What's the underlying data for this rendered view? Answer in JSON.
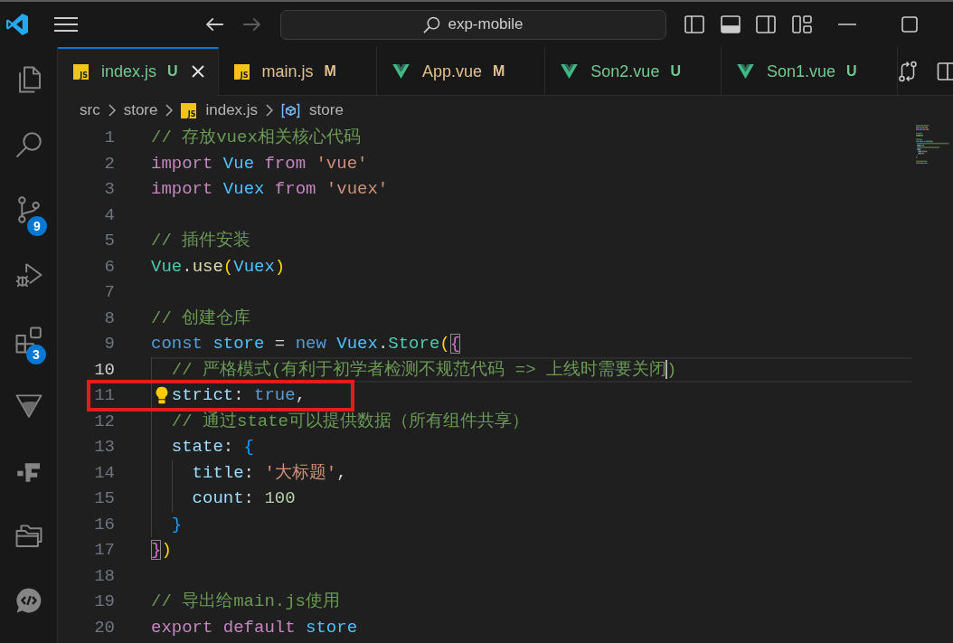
{
  "title_bar": {
    "navigation": [
      {
        "kind": "back",
        "disabled": false
      },
      {
        "kind": "forward",
        "disabled": true
      }
    ],
    "command_center": {
      "label": "exp-mobile"
    },
    "layout_toggles": [
      {
        "kind": "primary_sidebar",
        "on": false
      },
      {
        "kind": "panel",
        "on": true
      },
      {
        "kind": "secondary_sidebar",
        "on": false
      }
    ]
  },
  "activity_bar": [
    {
      "kind": "explorer"
    },
    {
      "kind": "search"
    },
    {
      "kind": "source_control",
      "badge": "9"
    },
    {
      "kind": "run_debug"
    },
    {
      "kind": "extensions",
      "badge": "3"
    },
    {
      "kind": "triangle"
    },
    {
      "kind": "blocks"
    },
    {
      "kind": "folders"
    },
    {
      "kind": "code_chat"
    }
  ],
  "tabs": [
    {
      "label": "index.js",
      "status": "U",
      "color": "#73c991",
      "icon": {
        "kind": "js",
        "text": "JS"
      },
      "selected": true
    },
    {
      "label": "main.js",
      "status": "M",
      "color": "#e2c08d",
      "icon": {
        "kind": "js",
        "text": "JS"
      },
      "selected": false
    },
    {
      "label": "App.vue",
      "status": "M",
      "color": "#e2c08d",
      "icon": {
        "kind": "vue"
      },
      "selected": false
    },
    {
      "label": "Son2.vue",
      "status": "U",
      "color": "#73c991",
      "icon": {
        "kind": "vue"
      },
      "selected": false
    },
    {
      "label": "Son1.vue",
      "status": "U",
      "color": "#73c991",
      "icon": {
        "kind": "vue"
      },
      "selected": false
    }
  ],
  "breadcrumbs": [
    {
      "label": "src"
    },
    {
      "label": "store"
    },
    {
      "label": "index.js",
      "icon": {
        "kind": "js",
        "text": "JS"
      }
    },
    {
      "label": "store",
      "icon": {
        "kind": "symbol"
      }
    }
  ],
  "editor": {
    "lines": [
      {
        "number": "1",
        "current": false,
        "lightbulb": false,
        "boxed": false,
        "tokens": [
          {
            "text": "// 存放vuex相关核心代码",
            "kind": "comment",
            "matched": false
          }
        ]
      },
      {
        "number": "2",
        "current": false,
        "lightbulb": false,
        "boxed": false,
        "tokens": [
          {
            "text": "import",
            "kind": "keyword",
            "matched": false
          },
          {
            "text": " Vue",
            "kind": "constant",
            "matched": false
          },
          {
            "text": " from",
            "kind": "keyword",
            "matched": false
          },
          {
            "text": " 'vue'",
            "kind": "string",
            "matched": false
          }
        ]
      },
      {
        "number": "3",
        "current": false,
        "lightbulb": false,
        "boxed": false,
        "tokens": [
          {
            "text": "import",
            "kind": "keyword",
            "matched": false
          },
          {
            "text": " Vuex",
            "kind": "constant",
            "matched": false
          },
          {
            "text": " from",
            "kind": "keyword",
            "matched": false
          },
          {
            "text": " 'vuex'",
            "kind": "string",
            "matched": false
          }
        ]
      },
      {
        "number": "4",
        "current": false,
        "lightbulb": false,
        "boxed": false
      },
      {
        "number": "5",
        "current": false,
        "lightbulb": false,
        "boxed": false,
        "tokens": [
          {
            "text": "// 插件安装",
            "kind": "comment",
            "matched": false
          }
        ]
      },
      {
        "number": "6",
        "current": false,
        "lightbulb": false,
        "boxed": false,
        "tokens": [
          {
            "text": "Vue",
            "kind": "class",
            "matched": false
          },
          {
            "text": ".",
            "kind": "punctuation",
            "matched": false
          },
          {
            "text": "use",
            "kind": "function",
            "matched": false
          },
          {
            "text": "(",
            "kind": "bracket1",
            "matched": false
          },
          {
            "text": "Vuex",
            "kind": "constant",
            "matched": false
          },
          {
            "text": ")",
            "kind": "bracket1",
            "matched": false
          }
        ]
      },
      {
        "number": "7",
        "current": false,
        "lightbulb": false,
        "boxed": false
      },
      {
        "number": "8",
        "current": false,
        "lightbulb": false,
        "boxed": false,
        "tokens": [
          {
            "text": "// 创建仓库",
            "kind": "comment",
            "matched": false
          }
        ]
      },
      {
        "number": "9",
        "current": false,
        "lightbulb": false,
        "boxed": false,
        "tokens": [
          {
            "text": "const",
            "kind": "storage",
            "matched": false
          },
          {
            "text": " store",
            "kind": "constant",
            "matched": false
          },
          {
            "text": " =",
            "kind": "punctuation",
            "matched": false
          },
          {
            "text": " new",
            "kind": "storage",
            "matched": false
          },
          {
            "text": " Vuex",
            "kind": "constant",
            "matched": false
          },
          {
            "text": ".",
            "kind": "punctuation",
            "matched": false
          },
          {
            "text": "Store",
            "kind": "class",
            "matched": false
          },
          {
            "text": "(",
            "kind": "bracket1",
            "matched": false
          },
          {
            "text": "{",
            "kind": "bracket2",
            "matched": true
          }
        ]
      },
      {
        "number": "10",
        "current": true,
        "lightbulb": false,
        "boxed": false,
        "tokens": [
          {
            "text": "  // 严格模式(有利于初学者检测不规范代码 => 上线时需要关闭",
            "kind": "comment",
            "matched": false
          },
          {
            "kind": "cursor",
            "matched": false
          },
          {
            "text": ")",
            "kind": "comment",
            "matched": false
          }
        ]
      },
      {
        "number": "11",
        "current": false,
        "lightbulb": true,
        "boxed": true,
        "tokens": [
          {
            "text": "  strict",
            "kind": "property",
            "matched": false
          },
          {
            "text": ":",
            "kind": "punctuation",
            "matched": false
          },
          {
            "text": " true",
            "kind": "storage",
            "matched": false
          },
          {
            "text": ",",
            "kind": "punctuation",
            "matched": false
          }
        ]
      },
      {
        "number": "12",
        "current": false,
        "lightbulb": false,
        "boxed": false,
        "tokens": [
          {
            "text": "  // 通过state可以提供数据（所有组件共享）",
            "kind": "comment",
            "matched": false
          }
        ]
      },
      {
        "number": "13",
        "current": false,
        "lightbulb": false,
        "boxed": false,
        "tokens": [
          {
            "text": "  state",
            "kind": "property",
            "matched": false
          },
          {
            "text": ":",
            "kind": "punctuation",
            "matched": false
          },
          {
            "text": " {",
            "kind": "bracket3",
            "matched": false
          }
        ]
      },
      {
        "number": "14",
        "current": false,
        "lightbulb": false,
        "boxed": false,
        "tokens": [
          {
            "text": "    title",
            "kind": "property",
            "matched": false
          },
          {
            "text": ":",
            "kind": "punctuation",
            "matched": false
          },
          {
            "text": " '大标题'",
            "kind": "string",
            "matched": false
          },
          {
            "text": ",",
            "kind": "punctuation",
            "matched": false
          }
        ]
      },
      {
        "number": "15",
        "current": false,
        "lightbulb": false,
        "boxed": false,
        "tokens": [
          {
            "text": "    count",
            "kind": "property",
            "matched": false
          },
          {
            "text": ":",
            "kind": "punctuation",
            "matched": false
          },
          {
            "text": " 100",
            "kind": "number",
            "matched": false
          }
        ]
      },
      {
        "number": "16",
        "current": false,
        "lightbulb": false,
        "boxed": false,
        "tokens": [
          {
            "text": "  }",
            "kind": "bracket3",
            "matched": false
          }
        ]
      },
      {
        "number": "17",
        "current": false,
        "lightbulb": false,
        "boxed": false,
        "tokens": [
          {
            "text": "}",
            "kind": "bracket2",
            "matched": true
          },
          {
            "text": ")",
            "kind": "bracket1",
            "matched": false
          }
        ]
      },
      {
        "number": "18",
        "current": false,
        "lightbulb": false,
        "boxed": false
      },
      {
        "number": "19",
        "current": false,
        "lightbulb": false,
        "boxed": false,
        "tokens": [
          {
            "text": "// 导出给main.js使用",
            "kind": "comment",
            "matched": false
          }
        ]
      },
      {
        "number": "20",
        "current": false,
        "lightbulb": false,
        "boxed": false,
        "tokens": [
          {
            "text": "export default",
            "kind": "keyword",
            "matched": false
          },
          {
            "text": " store",
            "kind": "constant",
            "matched": false
          }
        ]
      }
    ]
  }
}
